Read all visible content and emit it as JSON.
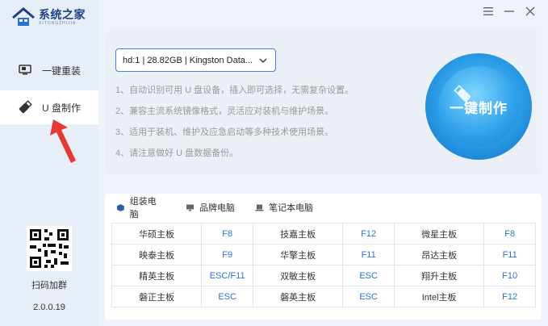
{
  "app": {
    "title": "系统之家",
    "subtitle": "XITONGZHIJIA",
    "version": "2.0.0.19"
  },
  "sidebar": {
    "items": [
      {
        "label": "一键重装",
        "icon": "monitor-icon",
        "active": false
      },
      {
        "label": "U 盘制作",
        "icon": "usb-drive-icon",
        "active": true
      }
    ],
    "qr_label": "扫码加群"
  },
  "main": {
    "device_select": {
      "value": "hd:1 | 28.82GB | Kingston Data..."
    },
    "tips": [
      "1、自动识别可用 U 盘设备，插入即可选择，无需复杂设置。",
      "2、兼容主流系统镜像格式，灵活应对装机与维护场景。",
      "3、适用于装机、维护及应急启动等多种技术使用场景。",
      "4、请注意做好 U 盘数据备份。"
    ],
    "action_button": "一键制作"
  },
  "tabs": [
    {
      "label": "组装电脑",
      "icon": "cube-icon",
      "active": true
    },
    {
      "label": "品牌电脑",
      "icon": "desktop-icon",
      "active": false
    },
    {
      "label": "笔记本电脑",
      "icon": "laptop-icon",
      "active": false
    }
  ],
  "boot_keys": [
    [
      {
        "brand": "华硕主板",
        "key": "F8"
      },
      {
        "brand": "技嘉主板",
        "key": "F12"
      },
      {
        "brand": "微星主板",
        "key": "F8"
      }
    ],
    [
      {
        "brand": "映泰主板",
        "key": "F9"
      },
      {
        "brand": "华擎主板",
        "key": "F11"
      },
      {
        "brand": "昂达主板",
        "key": "F11"
      }
    ],
    [
      {
        "brand": "精英主板",
        "key": "ESC/F11"
      },
      {
        "brand": "双敏主板",
        "key": "ESC"
      },
      {
        "brand": "翔升主板",
        "key": "F10"
      }
    ],
    [
      {
        "brand": "磐正主板",
        "key": "ESC"
      },
      {
        "brand": "磐英主板",
        "key": "ESC"
      },
      {
        "brand": "Intel主板",
        "key": "F12"
      }
    ]
  ],
  "colors": {
    "accent": "#2b6fd6",
    "sidebar_bg": "#e8eef8",
    "annotation_arrow": "#e53935"
  }
}
